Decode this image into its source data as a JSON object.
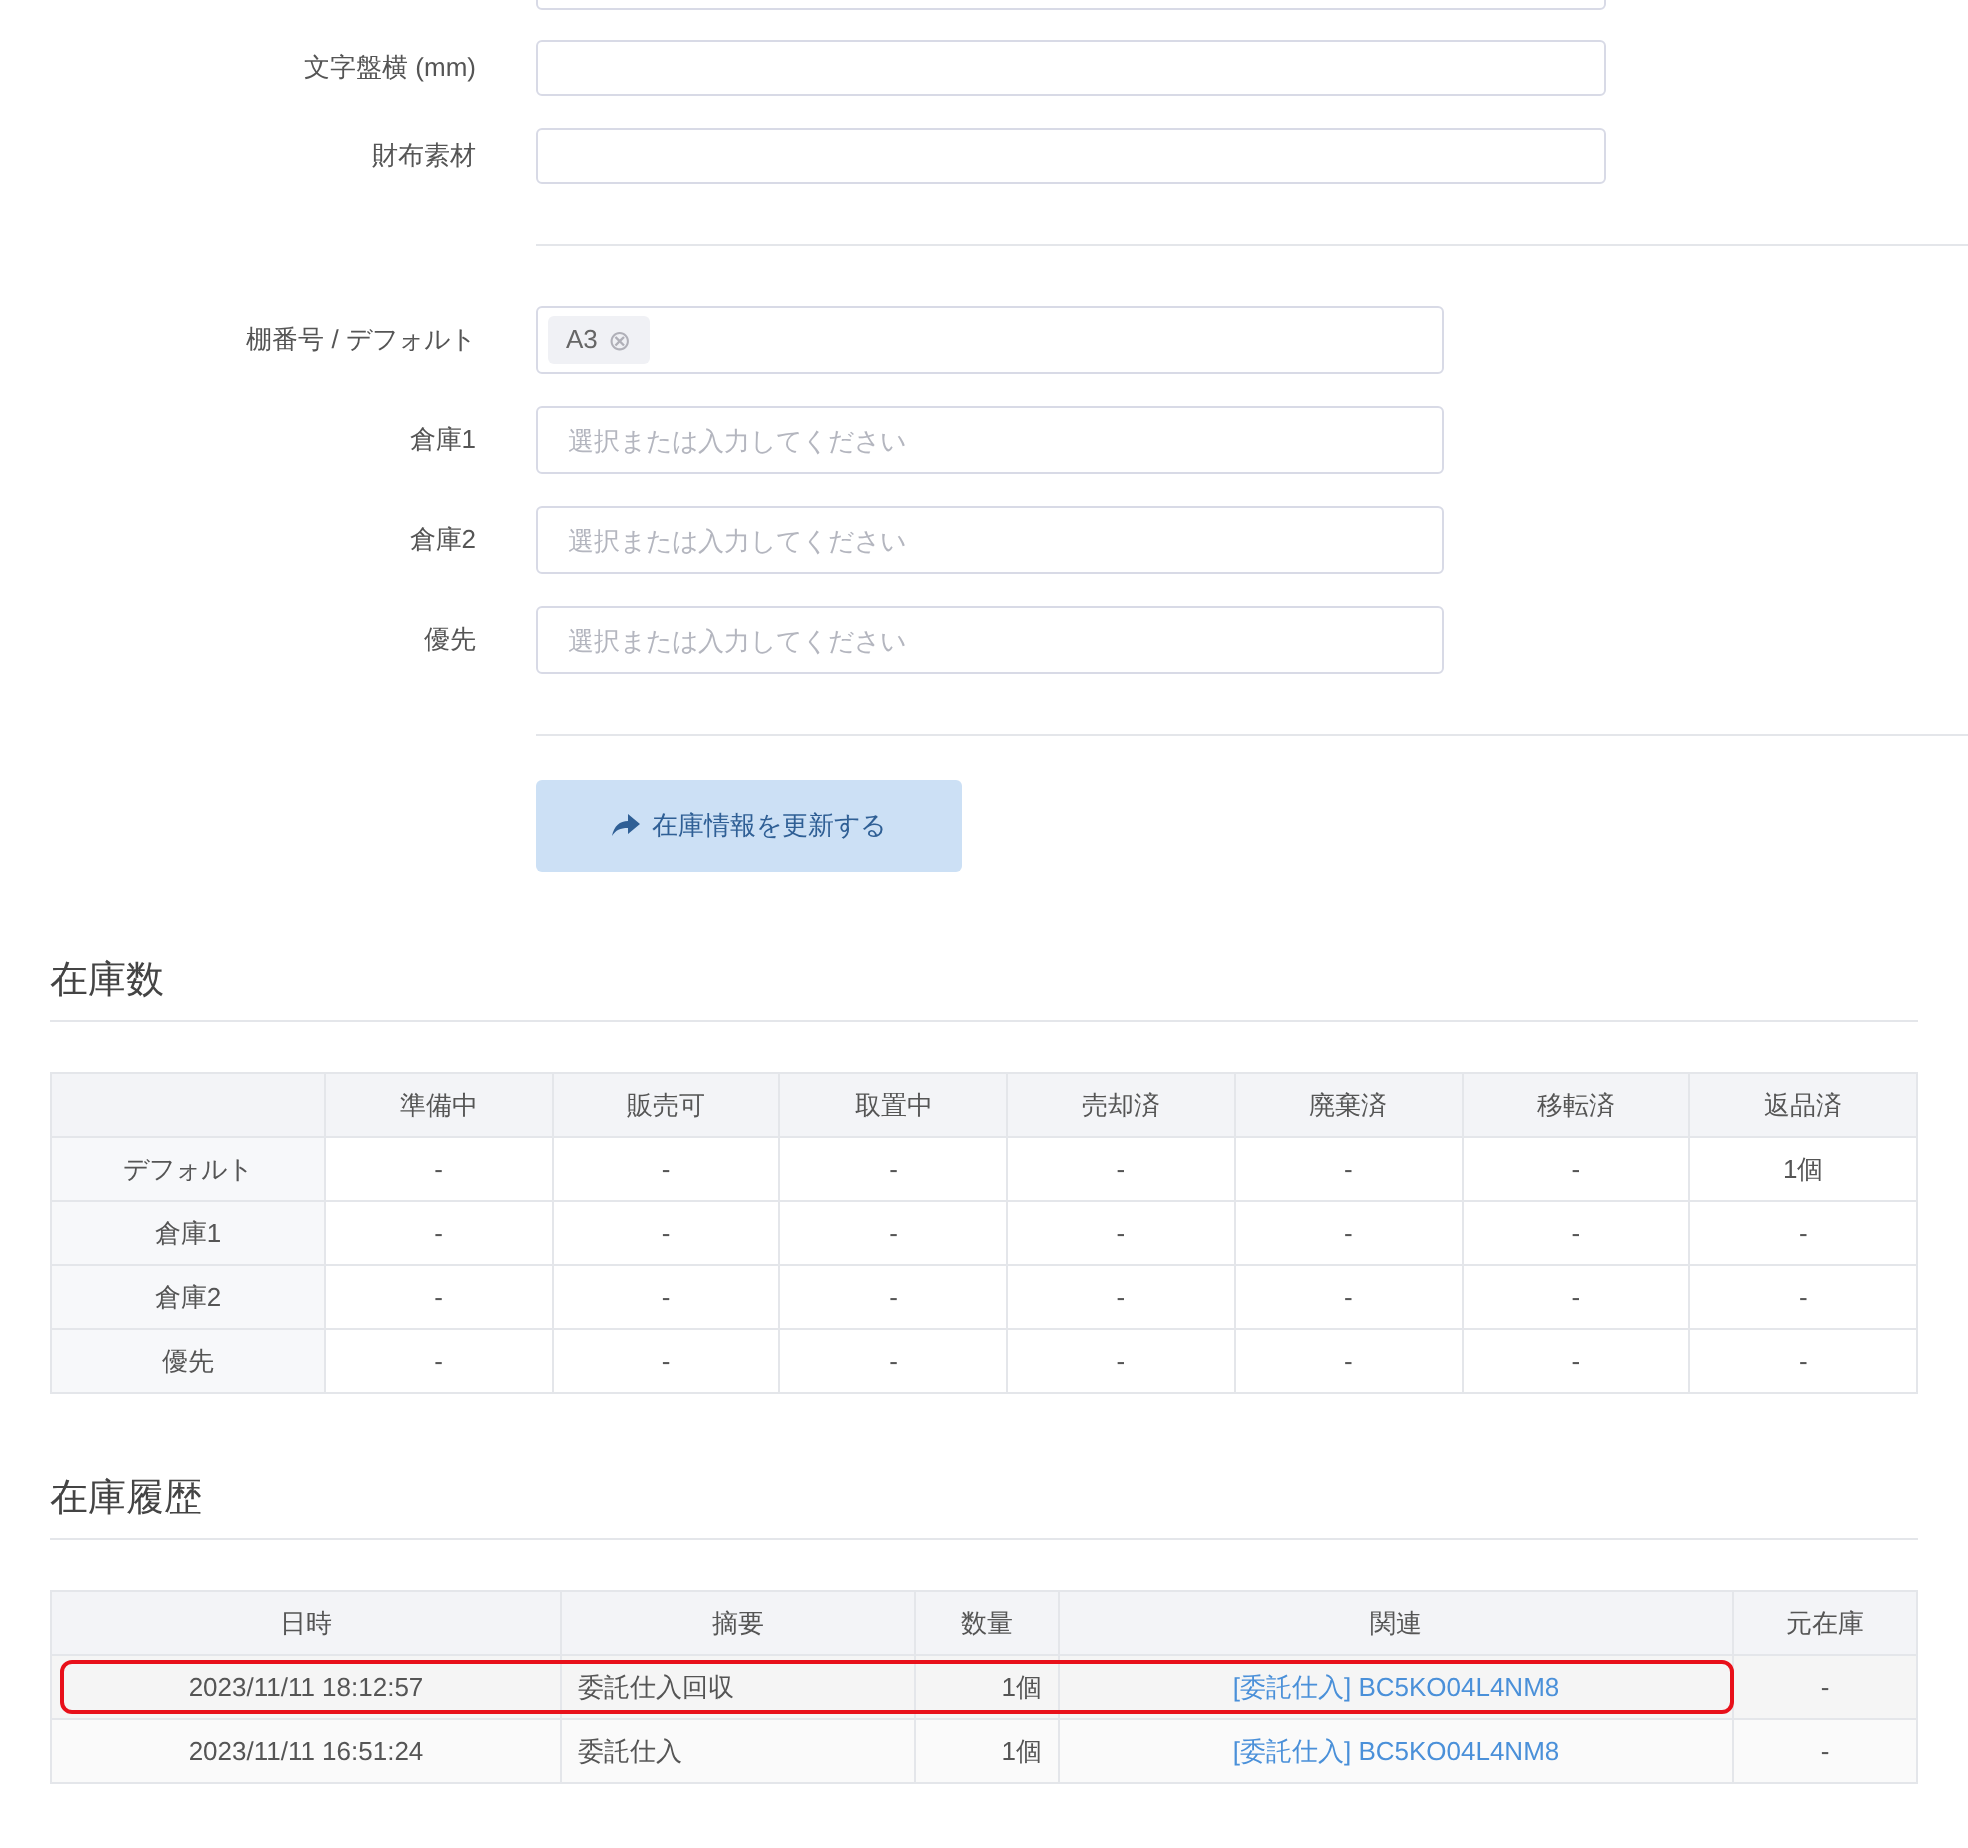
{
  "form_fields": [
    {
      "label": "文字盤横 (mm)",
      "kind": "text"
    },
    {
      "label": "財布素材",
      "kind": "text"
    },
    {
      "kind": "divider"
    },
    {
      "label": "棚番号 / デフォルト",
      "kind": "tags",
      "tags": [
        {
          "label": "A3",
          "remove": "⊗"
        }
      ]
    },
    {
      "label": "倉庫1",
      "kind": "select",
      "placeholder": "選択または入力してください"
    },
    {
      "label": "倉庫2",
      "kind": "select",
      "placeholder": "選択または入力してください"
    },
    {
      "label": "優先",
      "kind": "select",
      "placeholder": "選択または入力してください"
    },
    {
      "kind": "divider"
    }
  ],
  "update_button": {
    "label": "在庫情報を更新する"
  },
  "stock": {
    "title": "在庫数",
    "columns": [
      "準備中",
      "販売可",
      "取置中",
      "売却済",
      "廃棄済",
      "移転済",
      "返品済"
    ],
    "rows": [
      {
        "label": "デフォルト",
        "cells": [
          "-",
          "-",
          "-",
          "-",
          "-",
          "-",
          "1個"
        ]
      },
      {
        "label": "倉庫1",
        "cells": [
          "-",
          "-",
          "-",
          "-",
          "-",
          "-",
          "-"
        ]
      },
      {
        "label": "倉庫2",
        "cells": [
          "-",
          "-",
          "-",
          "-",
          "-",
          "-",
          "-"
        ]
      },
      {
        "label": "優先",
        "cells": [
          "-",
          "-",
          "-",
          "-",
          "-",
          "-",
          "-"
        ]
      }
    ]
  },
  "history": {
    "title": "在庫履歴",
    "columns": [
      "日時",
      "摘要",
      "数量",
      "関連",
      "元在庫"
    ],
    "rows": [
      {
        "datetime": "2023/11/11 18:12:57",
        "summary": "委託仕入回収",
        "quantity": "1個",
        "related": "[委託仕入] BC5KO04L4NM8",
        "source": "-",
        "highlighted": true
      },
      {
        "datetime": "2023/11/11 16:51:24",
        "summary": "委託仕入",
        "quantity": "1個",
        "related": "[委託仕入] BC5KO04L4NM8",
        "source": "-",
        "highlighted": false
      }
    ]
  }
}
